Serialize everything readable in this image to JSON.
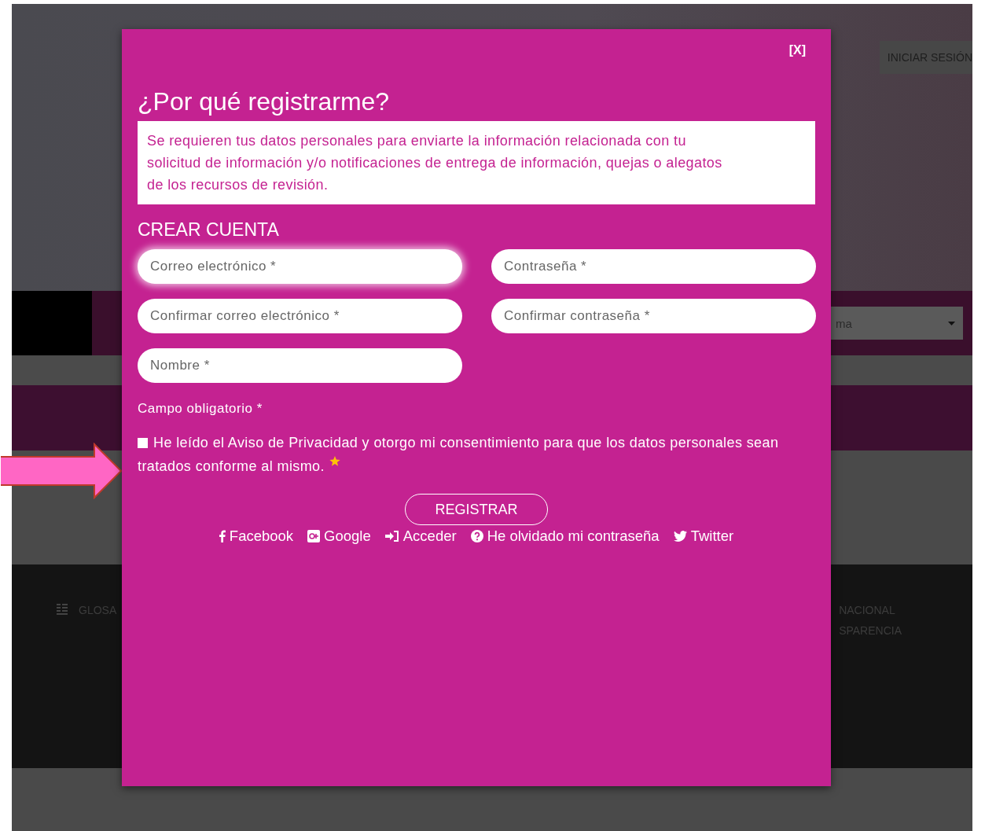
{
  "background": {
    "login_button": "INICIAR SESIÓN",
    "select_value": "ma",
    "footer_left": "GLOSA",
    "footer_right": [
      "NACIONAL",
      "SPARENCIA"
    ]
  },
  "modal": {
    "close": "[X]",
    "title": "¿Por qué registrarme?",
    "notice": "Se requieren tus datos personales para enviarte la información relacionada con tu solicitud de información y/o notificaciones de entrega de información, quejas o alegatos de los recursos de revisión.",
    "section": "CREAR CUENTA",
    "fields": [
      {
        "placeholder": "Correo electrónico *",
        "focused": true
      },
      {
        "placeholder": "Contraseña *",
        "focused": false
      },
      {
        "placeholder": "Confirmar correo electrónico *",
        "focused": false
      },
      {
        "placeholder": "Confirmar contraseña *",
        "focused": false
      },
      {
        "placeholder": "Nombre *",
        "focused": false
      }
    ],
    "required_note": "Campo obligatorio *",
    "consent": {
      "lines": [
        "He leído el Aviso de Privacidad y otorgo mi consentimiento para que los datos personales sean",
        "tratados conforme al mismo."
      ],
      "checked": false
    },
    "submit": "REGISTRAR",
    "links": [
      {
        "kind": "facebook",
        "label": "Facebook"
      },
      {
        "kind": "google",
        "label": "Google"
      },
      {
        "kind": "signin",
        "label": "Acceder"
      },
      {
        "kind": "help",
        "label": "He olvidado mi contraseña"
      },
      {
        "kind": "twitter",
        "label": "Twitter"
      }
    ]
  }
}
